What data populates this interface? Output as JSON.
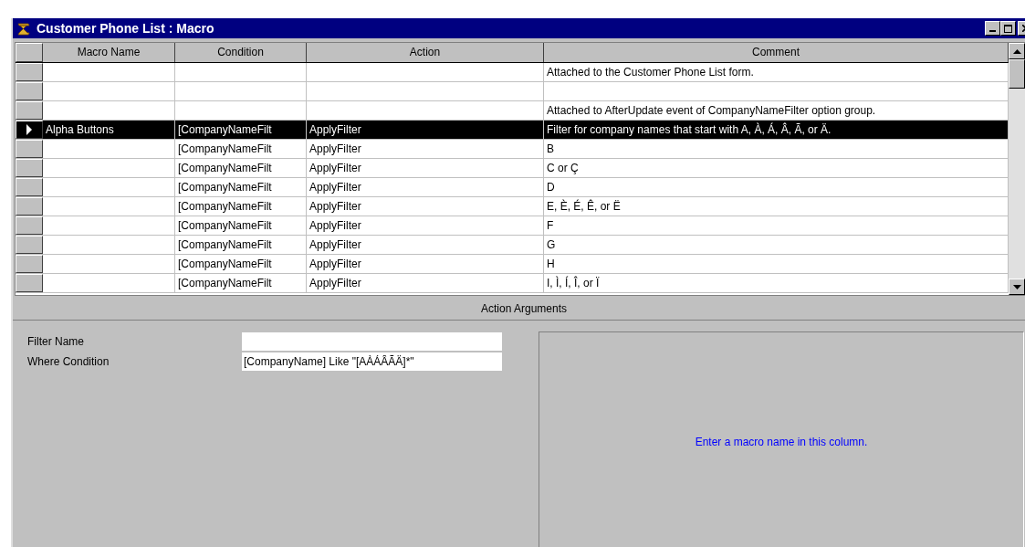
{
  "window": {
    "title": "Customer Phone List : Macro"
  },
  "table": {
    "columns": [
      "Macro Name",
      "Condition",
      "Action",
      "Comment"
    ],
    "rows": [
      {
        "comment": "Attached to the Customer Phone List form.",
        "selected": false
      },
      {
        "selected": false
      },
      {
        "comment": "Attached to AfterUpdate event of CompanyNameFilter option group.",
        "selected": false
      },
      {
        "macro_name": "Alpha Buttons",
        "condition": "[CompanyNameFilt",
        "action": "ApplyFilter",
        "comment": "Filter for company names that start with A, À, Á, Â, Ã, or Ä.",
        "selected": true
      },
      {
        "condition": "[CompanyNameFilt",
        "action": "ApplyFilter",
        "comment": "B",
        "selected": false
      },
      {
        "condition": "[CompanyNameFilt",
        "action": "ApplyFilter",
        "comment": "C or Ç",
        "selected": false
      },
      {
        "condition": "[CompanyNameFilt",
        "action": "ApplyFilter",
        "comment": "D",
        "selected": false
      },
      {
        "condition": "[CompanyNameFilt",
        "action": "ApplyFilter",
        "comment": "E, È, É, Ê, or Ë",
        "selected": false
      },
      {
        "condition": "[CompanyNameFilt",
        "action": "ApplyFilter",
        "comment": "F",
        "selected": false
      },
      {
        "condition": "[CompanyNameFilt",
        "action": "ApplyFilter",
        "comment": "G",
        "selected": false
      },
      {
        "condition": "[CompanyNameFilt",
        "action": "ApplyFilter",
        "comment": "H",
        "selected": false
      },
      {
        "condition": "[CompanyNameFilt",
        "action": "ApplyFilter",
        "comment": "I, Ì, Í, Î, or Ï",
        "selected": false
      }
    ]
  },
  "action_arguments": {
    "title": "Action Arguments",
    "fields": [
      {
        "label": "Filter Name"
      },
      {
        "label": "Where Condition",
        "value": "[CompanyName] Like \"[AÀÁÂÃÄ]*\""
      }
    ],
    "help_text": "Enter a macro name in this column."
  }
}
